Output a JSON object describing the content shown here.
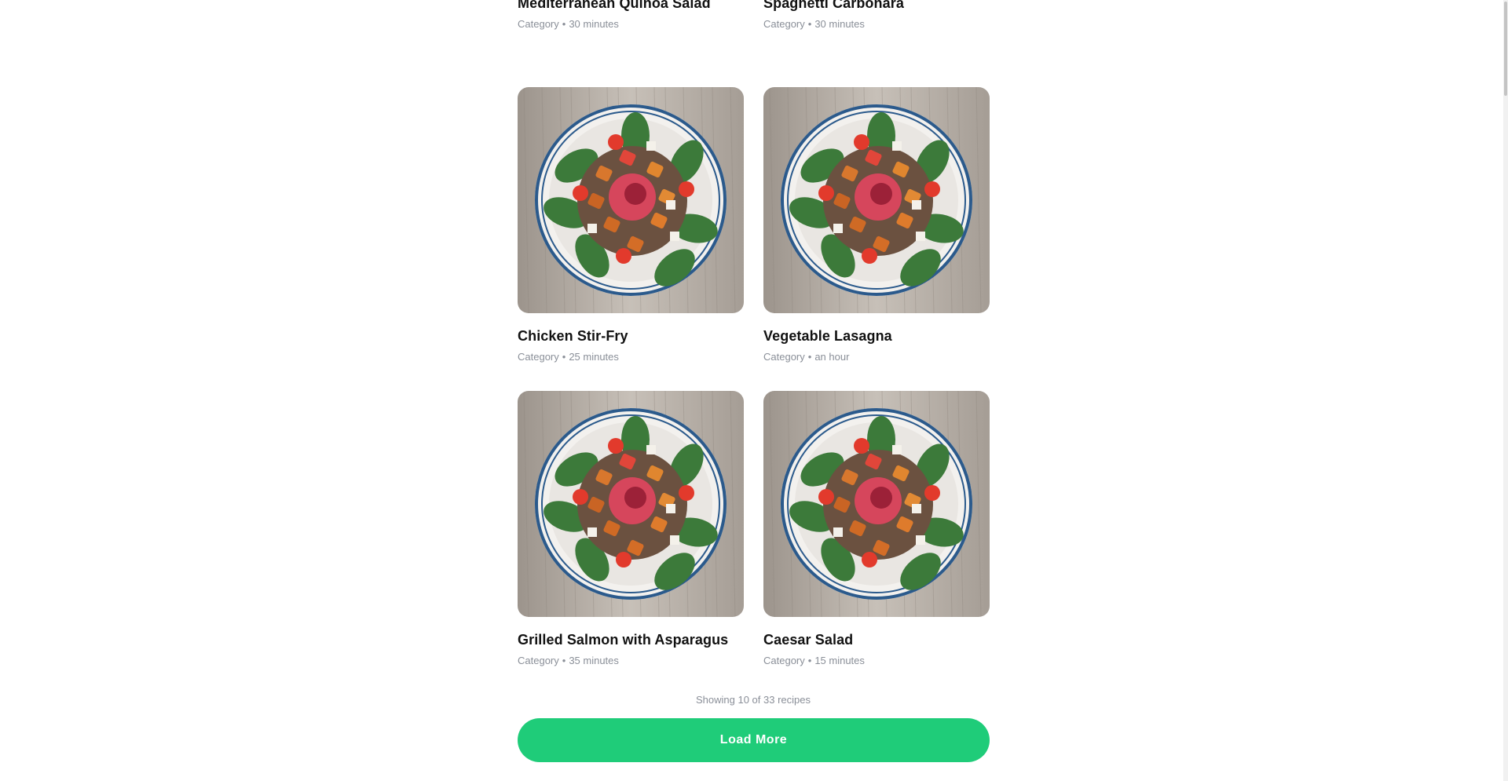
{
  "recipes": [
    {
      "title": "Mediterranean Quinoa Salad",
      "category": "Category",
      "time": "30 minutes"
    },
    {
      "title": "Spaghetti Carbonara",
      "category": "Category",
      "time": "30 minutes"
    },
    {
      "title": "Chicken Stir-Fry",
      "category": "Category",
      "time": "25 minutes"
    },
    {
      "title": "Vegetable Lasagna",
      "category": "Category",
      "time": "an hour"
    },
    {
      "title": "Grilled Salmon with Asparagus",
      "category": "Category",
      "time": "35 minutes"
    },
    {
      "title": "Caesar Salad",
      "category": "Category",
      "time": "15 minutes"
    }
  ],
  "separator": "•",
  "footer": {
    "showing_text": "Showing 10 of 33 recipes",
    "load_more_label": "Load More"
  },
  "colors": {
    "accent": "#1fcc79",
    "meta_text": "#8a8f98",
    "title_text": "#111111"
  },
  "image": {
    "alt": "recipe-photo"
  }
}
